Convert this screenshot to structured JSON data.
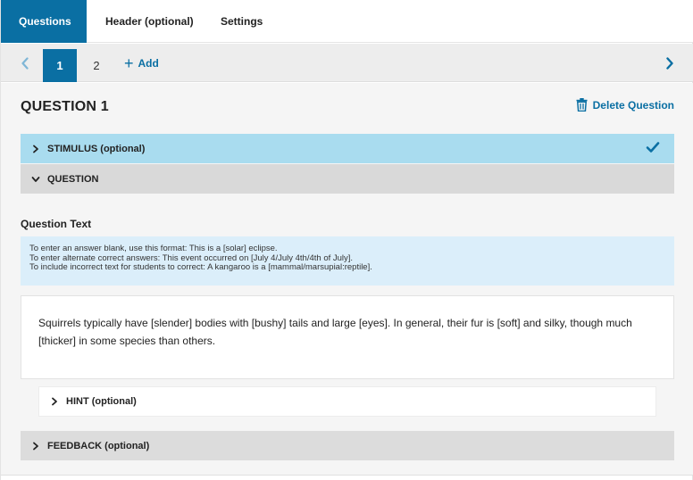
{
  "tabs": [
    {
      "label": "Questions",
      "active": true
    },
    {
      "label": "Header (optional)",
      "active": false
    },
    {
      "label": "Settings",
      "active": false
    }
  ],
  "pagination": {
    "pages": [
      "1",
      "2"
    ],
    "active_page": "1",
    "add_label": "Add",
    "prev_icon": "chevron-left-icon",
    "next_icon": "chevron-right-icon"
  },
  "question": {
    "title": "QUESTION 1",
    "delete_label": "Delete Question",
    "delete_icon": "trash-icon"
  },
  "sections": {
    "stimulus": {
      "label": "STIMULUS (optional)",
      "expanded": false,
      "complete": true
    },
    "question": {
      "label": "QUESTION",
      "expanded": true
    },
    "hint": {
      "label": "HINT (optional)",
      "expanded": false
    },
    "feedback": {
      "label": "FEEDBACK (optional)",
      "expanded": false
    }
  },
  "question_text": {
    "label": "Question Text",
    "help": [
      "To enter an answer blank, use this format: This is a [solar] eclipse.",
      "To enter alternate correct answers: This event occurred on [July 4/July 4th/4th of July].",
      "To include incorrect text for students to correct: A kangaroo is a [mammal/marsupial:reptile]."
    ],
    "value": "Squirrels typically have [slender] bodies with [bushy] tails and large [eyes]. In general, their fur is [soft] and silky, though much [thicker] in some species than others."
  },
  "colors": {
    "accent": "#0a6fa3",
    "stimulus_bg": "#a9dcef",
    "section_bg": "#d9d9d9",
    "help_bg": "#dbeefa"
  }
}
